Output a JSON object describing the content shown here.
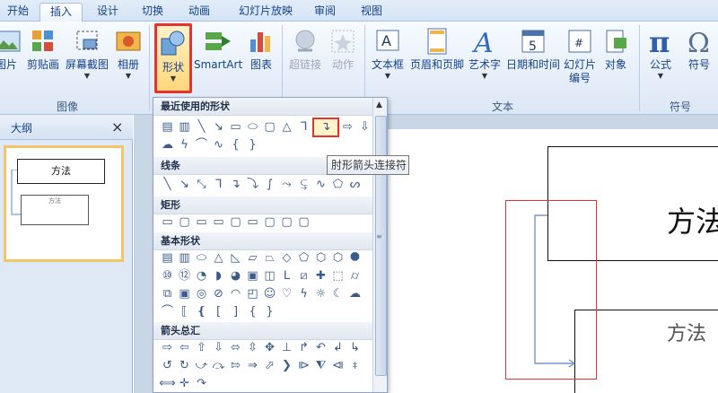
{
  "tabs": [
    {
      "label": "开始"
    },
    {
      "label": "插入"
    },
    {
      "label": "设计"
    },
    {
      "label": "切换"
    },
    {
      "label": "动画"
    },
    {
      "label": "幻灯片放映"
    },
    {
      "label": "审阅"
    },
    {
      "label": "视图"
    }
  ],
  "ribbon": {
    "images_group": {
      "label": "图像",
      "picture": "图片",
      "clipart": "剪贴画",
      "screenshot": "屏幕截图",
      "album": "相册"
    },
    "illustrations": {
      "shapes": "形状",
      "smartart": "SmartArt",
      "chart": "图表"
    },
    "links": {
      "hyperlink": "超链接",
      "action": "动作"
    },
    "text_group": {
      "label": "文本",
      "textbox": "文本框",
      "header_footer": "页眉和页脚",
      "wordart": "艺术字",
      "datetime": "日期和时间",
      "slide_number_line1": "幻灯片",
      "slide_number_line2": "编号",
      "object": "对象"
    },
    "symbols_group": {
      "label": "符号",
      "equation": "公式",
      "symbol": "符号"
    }
  },
  "outline_pane": {
    "title": "大纲",
    "close": "×",
    "thumb_title": "方法",
    "thumb_sub": "方法"
  },
  "slide": {
    "box1_text": "方法",
    "box2_text": "方法"
  },
  "shapes_menu": {
    "recent": "最近使用的形状",
    "lines": "线条",
    "rect": "矩形",
    "basic": "基本形状",
    "arrows": "箭头总汇",
    "tooltip": "肘形箭头连接符"
  },
  "colors": {
    "highlight_red": "#e8332c",
    "ribbon_blue": "#15428b"
  }
}
